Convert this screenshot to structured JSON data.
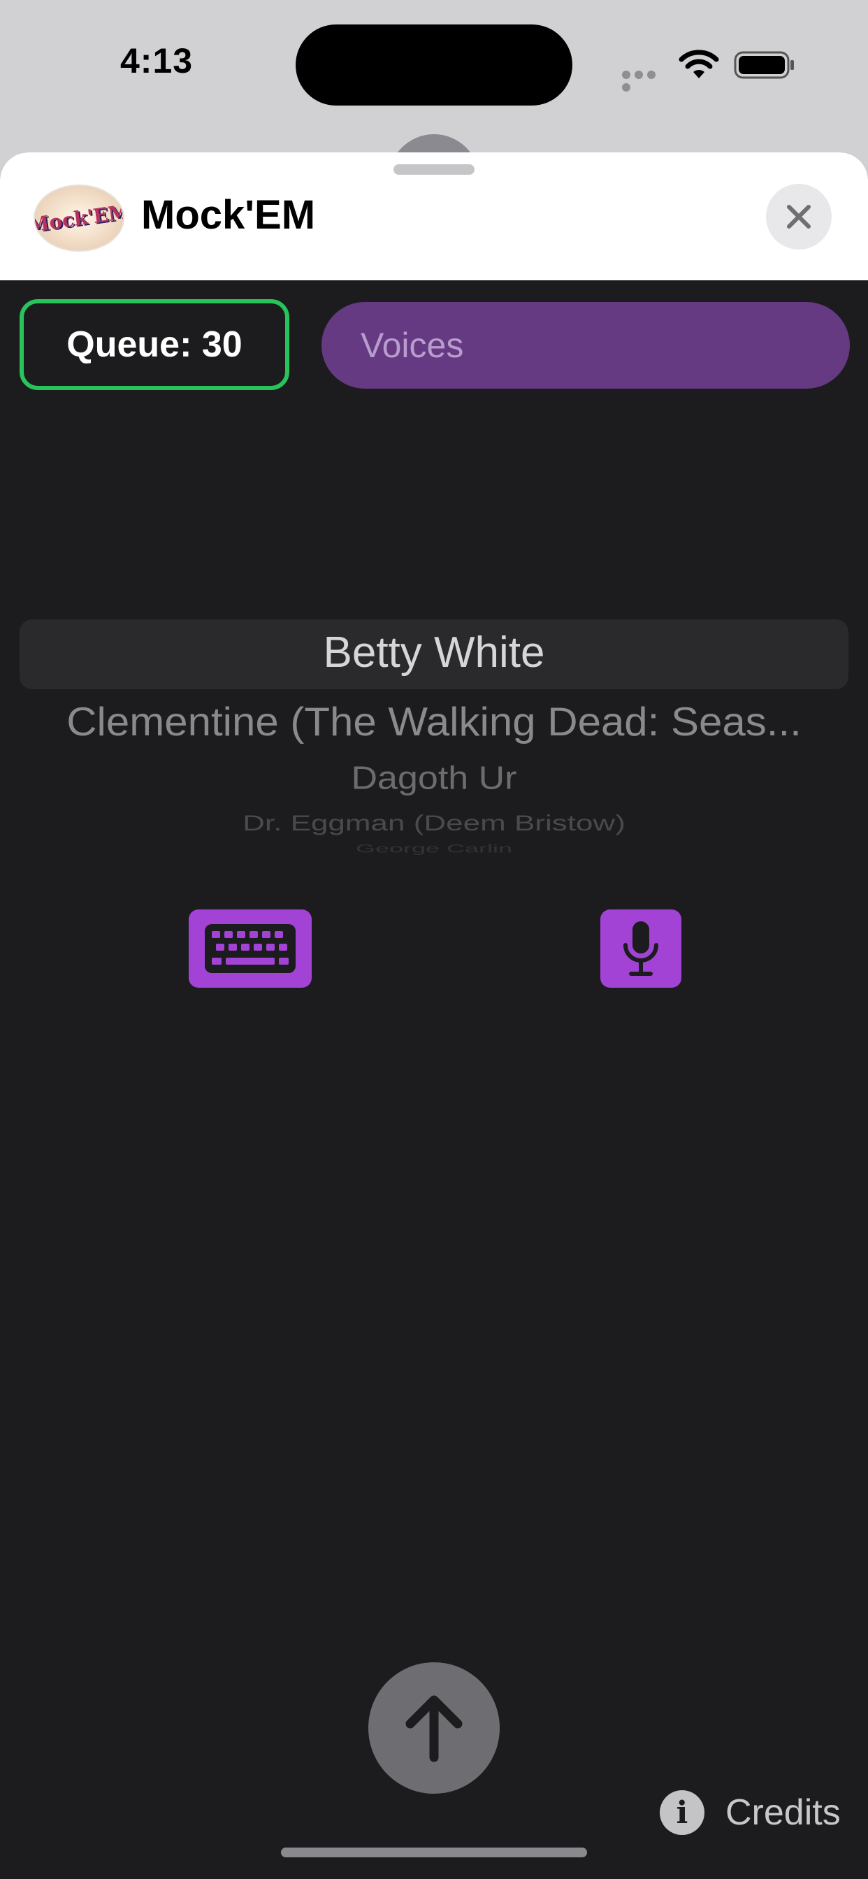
{
  "status_bar": {
    "time": "4:13"
  },
  "header": {
    "title": "Mock'EM",
    "logo_text": "Mock'EM"
  },
  "queue": {
    "label": "Queue: 30"
  },
  "voices": {
    "placeholder": "Voices"
  },
  "voice_picker": {
    "options": [
      "Betty White",
      "Clementine (The Walking Dead: Seas...",
      "Dagoth Ur",
      "Dr. Eggman (Deem Bristow)",
      "George Carlin"
    ],
    "selected_index": 0
  },
  "icons": {
    "close": "close-icon",
    "keyboard": "keyboard-icon",
    "microphone": "microphone-icon",
    "send": "arrow-up-icon",
    "info": "info-icon"
  },
  "footer": {
    "credits_label": "Credits"
  },
  "colors": {
    "accent_purple": "#a243d6",
    "voices_bg": "#663a82",
    "queue_border": "#28c35a",
    "sheet_bg": "#1c1c1e"
  }
}
